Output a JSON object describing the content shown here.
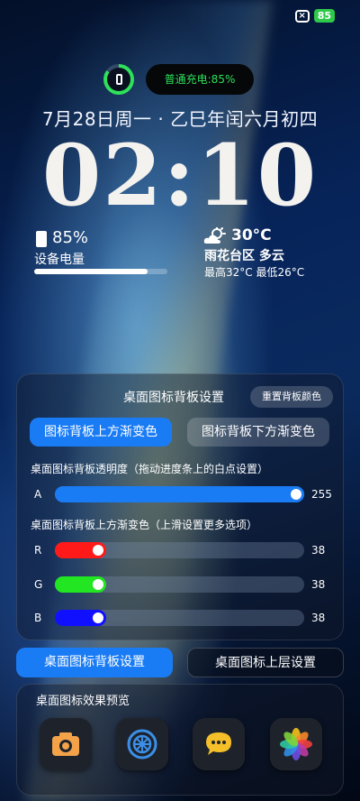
{
  "status_bar": {
    "close_badge": "×",
    "battery": "85"
  },
  "charging": {
    "label": "普通充电:85%",
    "level_percent": 85
  },
  "lockscreen": {
    "date": "7月28日周一 · 乙巳年闰六月初四",
    "time": "02:10"
  },
  "battery_widget": {
    "percent": "85%",
    "label": "设备电量",
    "level_fraction": 0.85
  },
  "weather": {
    "temperature": "30°C",
    "location": "雨花台区 多云",
    "range": "最高32°C 最低26°C",
    "icon": "partly-cloudy-icon"
  },
  "panel": {
    "title": "桌面图标背板设置",
    "reset_label": "重置背板颜色",
    "tab_top": "图标背板上方渐变色",
    "tab_bottom": "图标背板下方渐变色",
    "opacity_section": "桌面图标背板透明度（拖动进度条上的白点设置）",
    "gradient_section": "桌面图标背板上方渐变色（上滑设置更多选项）",
    "sliders": [
      {
        "label": "A",
        "value": "255",
        "fraction": 1.0,
        "color": "#1a7cf5"
      },
      {
        "label": "R",
        "value": "38",
        "fraction": 0.149,
        "color": "#ff1a1a"
      },
      {
        "label": "G",
        "value": "38",
        "fraction": 0.149,
        "color": "#22e622"
      },
      {
        "label": "B",
        "value": "38",
        "fraction": 0.149,
        "color": "#1010ff"
      }
    ]
  },
  "bottom_tabs": {
    "background": "桌面图标背板设置",
    "foreground": "桌面图标上层设置"
  },
  "preview": {
    "title": "桌面图标效果预览",
    "apps": [
      "camera-icon",
      "settings-icon",
      "messages-icon",
      "photos-icon"
    ]
  },
  "colors": {
    "accent": "#1a7cf5",
    "charge_green": "#2ee05a"
  }
}
